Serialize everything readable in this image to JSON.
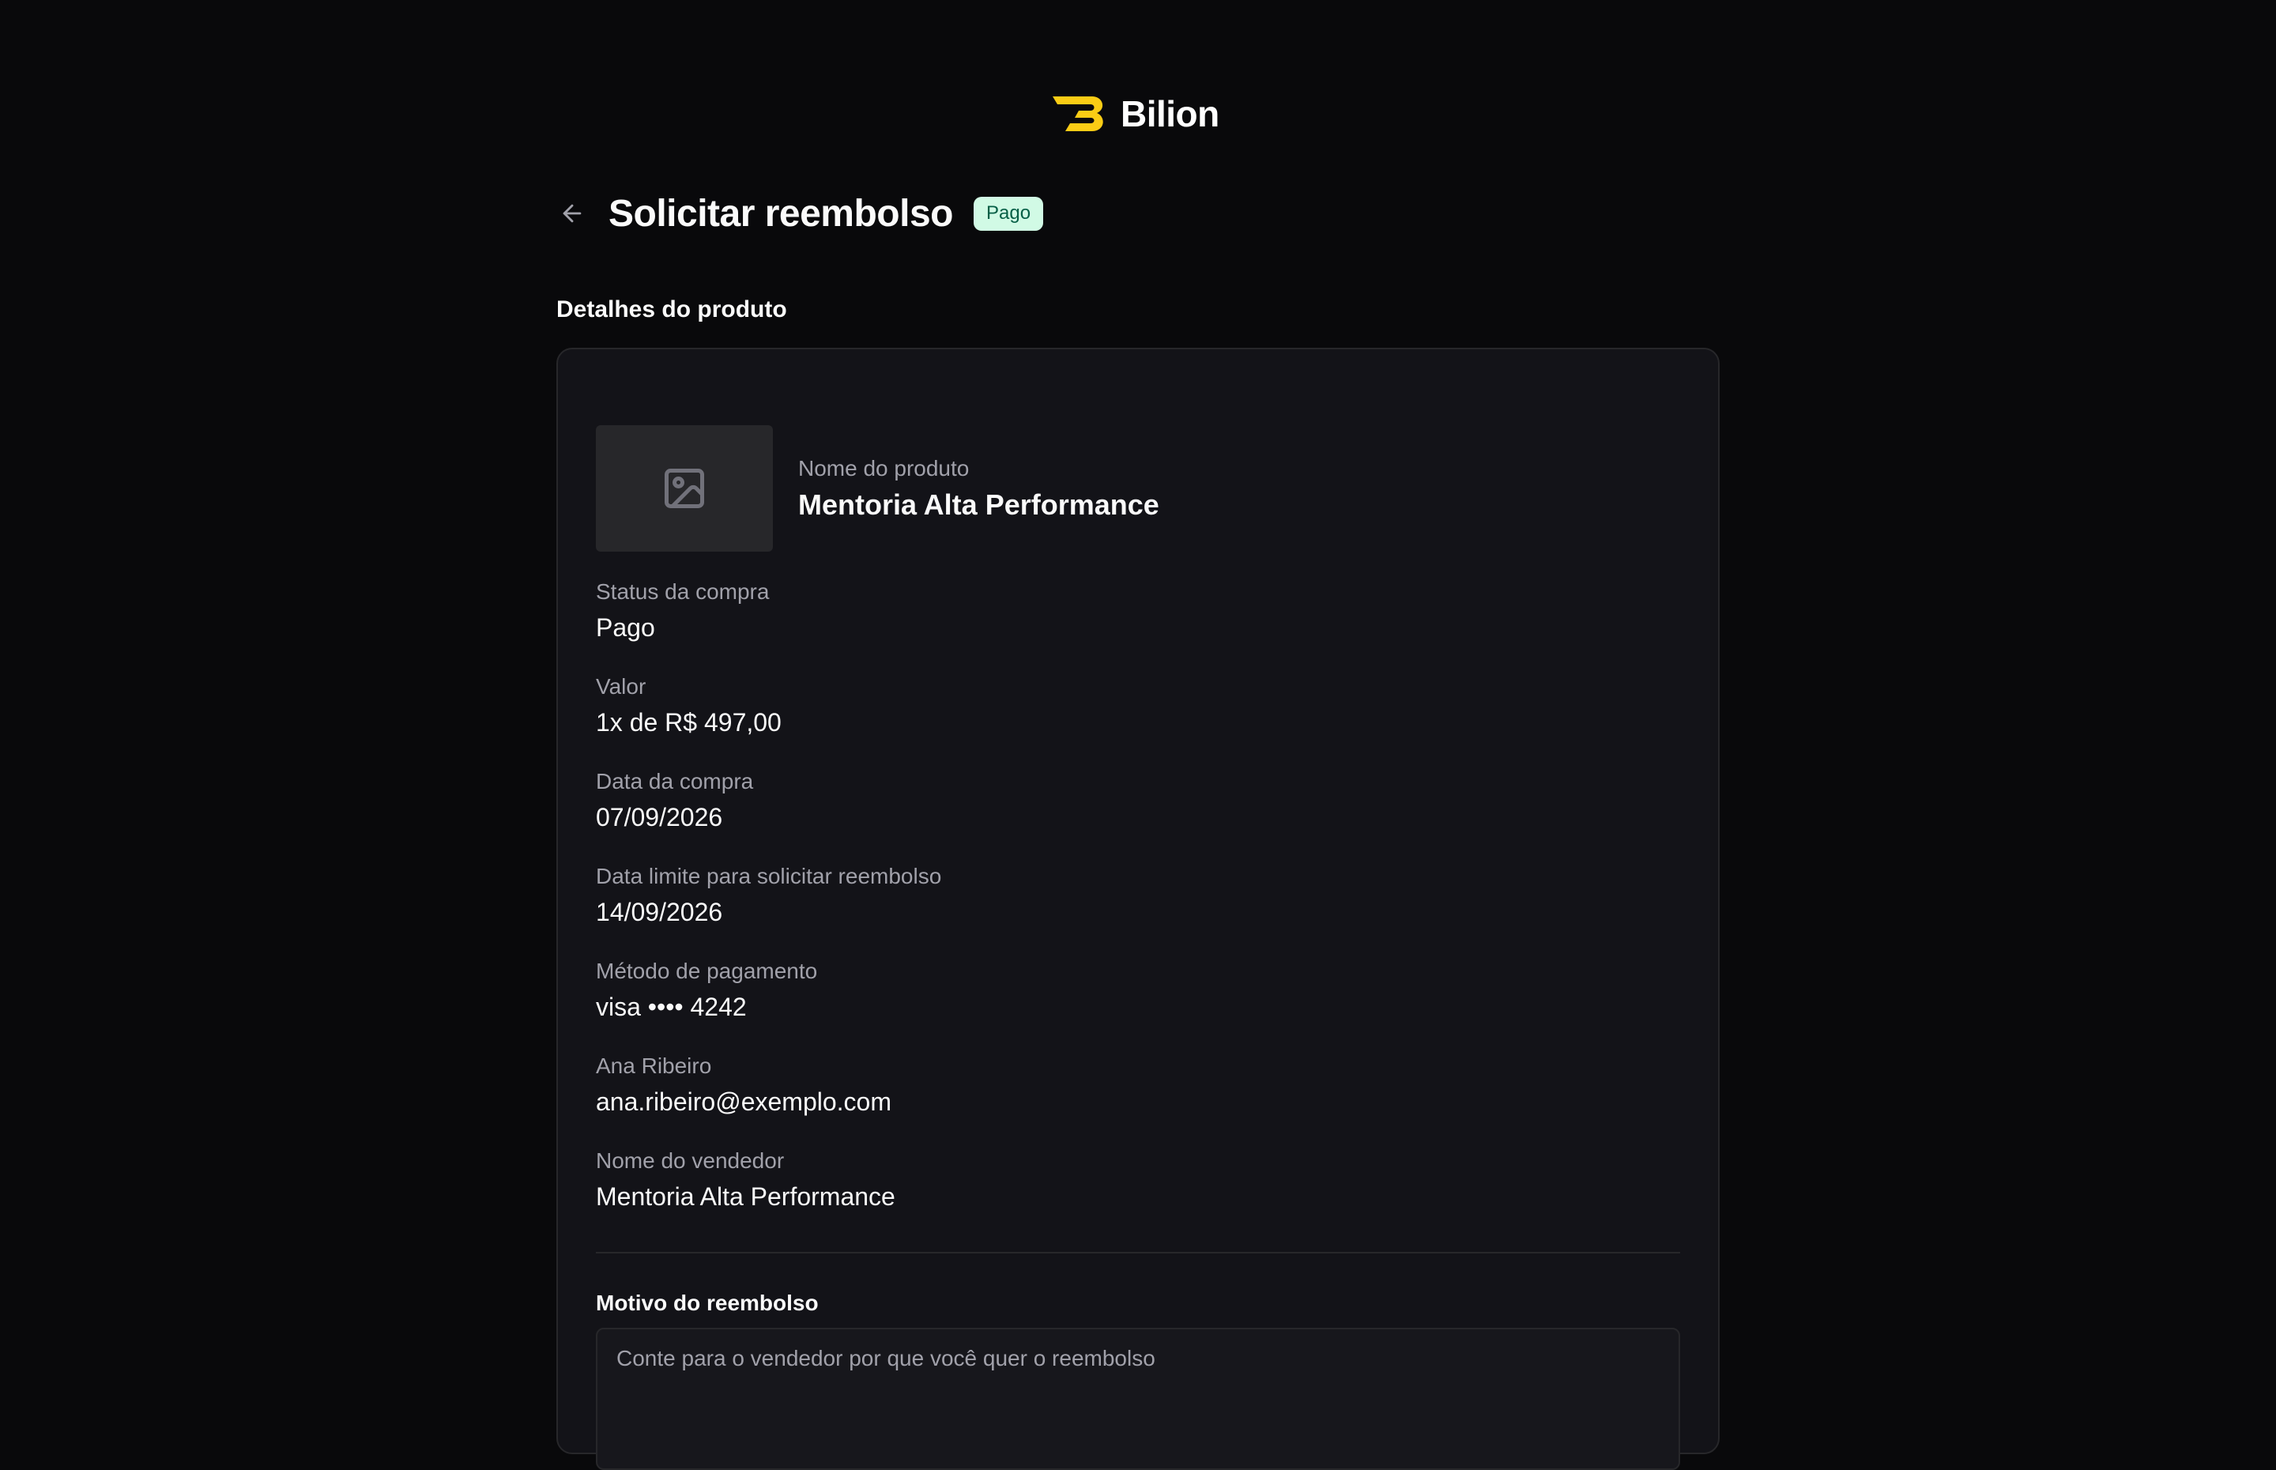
{
  "brand": {
    "name": "Bilion",
    "accent_color": "#facc15"
  },
  "header": {
    "back_icon": "arrow-left-icon",
    "title": "Solicitar reembolso",
    "status_badge": "Pago",
    "status_badge_color": "#d1fae5"
  },
  "section_title": "Detalhes do produto",
  "product": {
    "thumbnail_icon": "image-placeholder-icon",
    "name_label": "Nome do produto",
    "name": "Mentoria Alta Performance"
  },
  "details": [
    {
      "label": "Status da compra",
      "value": "Pago"
    },
    {
      "label": "Valor",
      "value": "1x de R$ 497,00"
    },
    {
      "label": "Data da compra",
      "value": "07/09/2026"
    },
    {
      "label": "Data limite para solicitar reembolso",
      "value": "14/09/2026"
    },
    {
      "label": "Método de pagamento",
      "value": "visa •••• 4242"
    },
    {
      "label": "Ana Ribeiro",
      "value": "ana.ribeiro@exemplo.com"
    },
    {
      "label": "Nome do vendedor",
      "value": "Mentoria Alta Performance"
    }
  ],
  "refund_reason": {
    "label": "Motivo do reembolso",
    "placeholder": "Conte para o vendedor por que você quer o reembolso",
    "value": ""
  }
}
